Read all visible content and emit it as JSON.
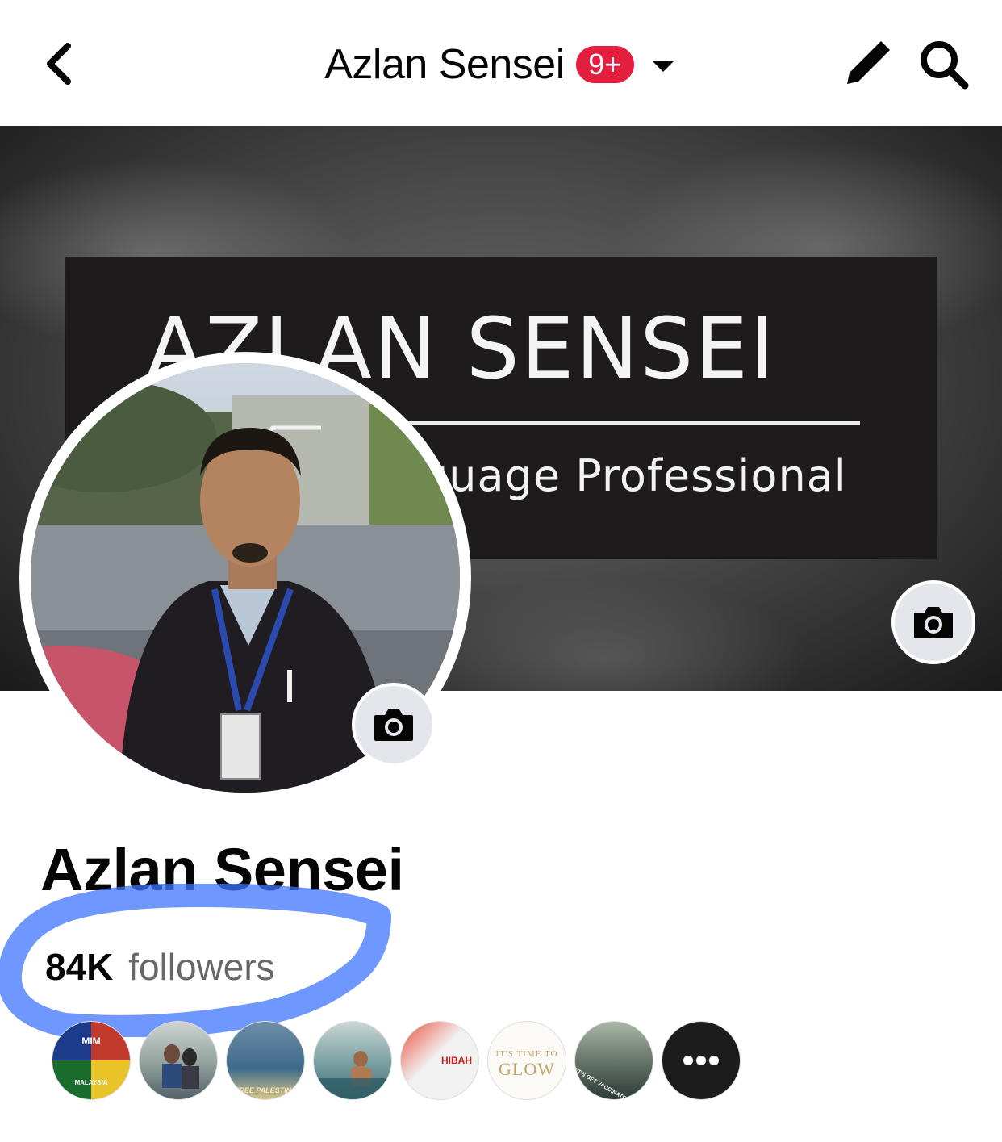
{
  "header": {
    "title": "Azlan Sensei",
    "notification_badge": "9+",
    "back_icon": "chevron-left-icon",
    "edit_icon": "pencil-icon",
    "search_icon": "search-icon",
    "badge_color": "#e41e3f"
  },
  "cover": {
    "banner_title": "AZLAN SENSEI",
    "banner_subtitle": "guage Professional",
    "camera_icon": "camera-icon"
  },
  "profile": {
    "name": "Azlan Sensei",
    "followers_count": "84K",
    "followers_label": "followers",
    "highlight_color": "#2f6bff"
  },
  "liked_pages": {
    "items": [
      {
        "name": "page-mim",
        "text": "MIM",
        "sub": "MALAYSIA"
      },
      {
        "name": "page-couple",
        "text": ""
      },
      {
        "name": "page-free-palestine",
        "text": "FREE PALESTINE"
      },
      {
        "name": "page-swimmer",
        "text": ""
      },
      {
        "name": "page-hibah",
        "text": "HIBAH"
      },
      {
        "name": "page-glow",
        "text": "IT'S TIME TO",
        "sub": "GLOW"
      },
      {
        "name": "page-vaccinated",
        "text": "LET'S GET VACCINATED"
      }
    ],
    "more_icon": "more-dots-icon"
  }
}
